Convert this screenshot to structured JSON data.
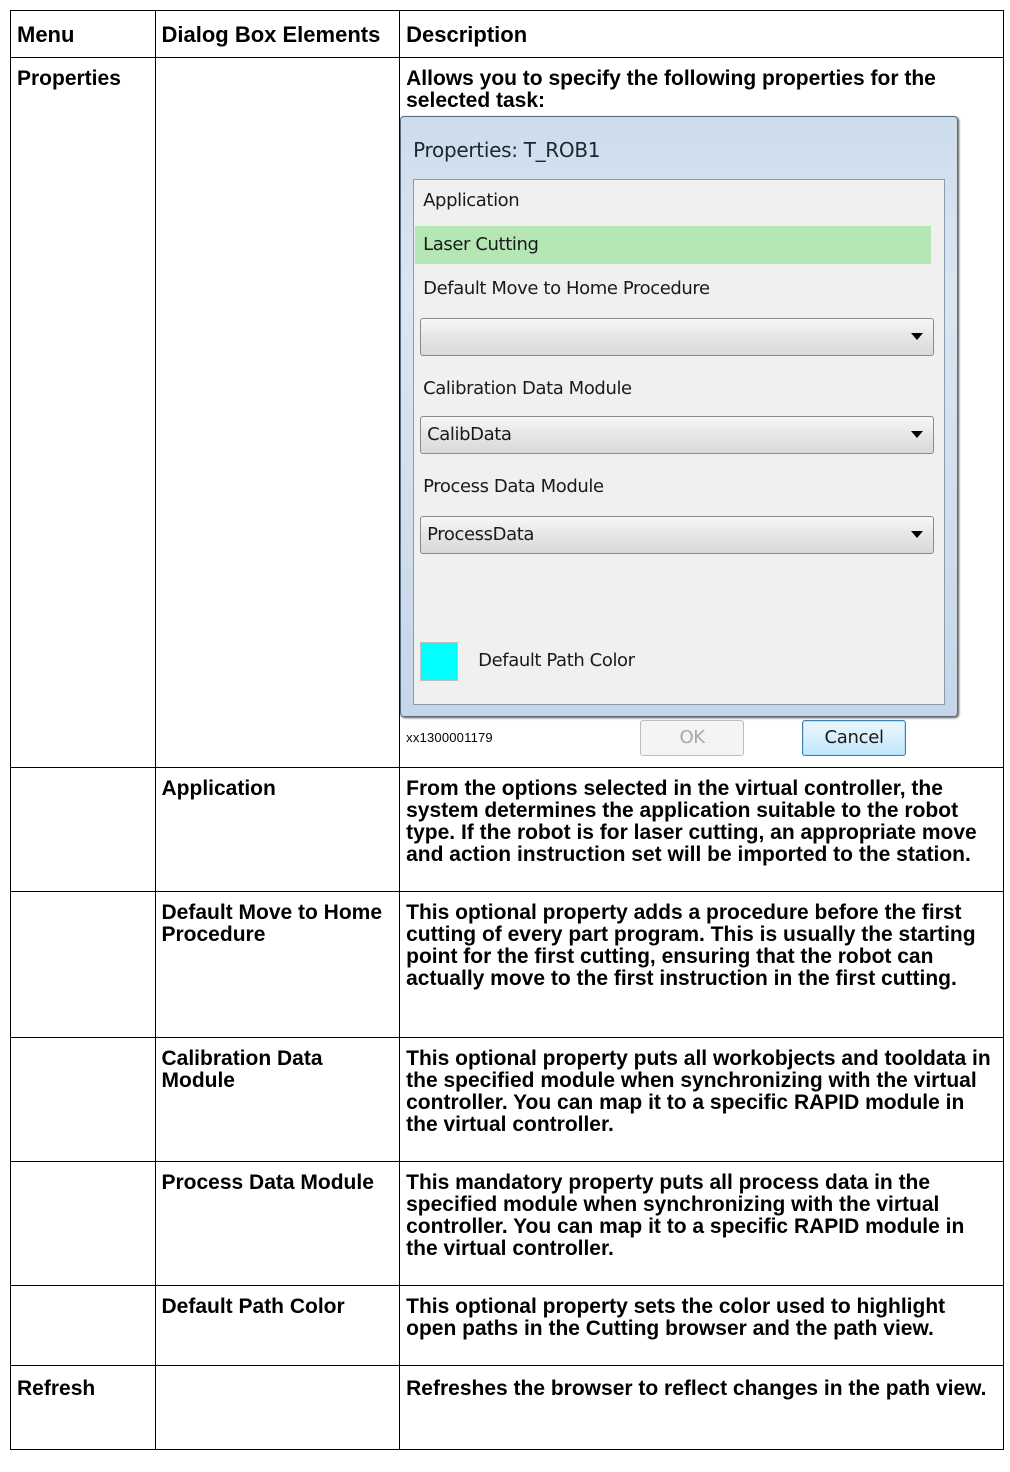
{
  "table": {
    "headers": [
      "Menu",
      "Dialog Box Elements",
      "Description"
    ],
    "rows": {
      "properties": {
        "menu": "Properties",
        "element": "",
        "description": "Allows you to specify the following properties for the selected task:"
      },
      "application": {
        "menu": "",
        "element": "Application",
        "description": "From the options selected in the virtual controller, the system determines the application suitable to the robot type. If the robot is for laser cutting, an appropriate move and action instruction set will be imported to the station."
      },
      "move_home": {
        "menu": "",
        "element": "Default Move to Home Procedure",
        "description": "This optional property adds a procedure before the first cutting of every part program. This is usually the starting point for the first cutting, ensuring that the robot can actually move to the first instruction in the first cutting."
      },
      "calibration": {
        "menu": "",
        "element": "Calibration Data Module",
        "description": "This optional property puts all workobjects and tooldata in the specified module when synchronizing with the virtual controller. You can map it to a specific RAPID module in the virtual controller."
      },
      "process": {
        "menu": "",
        "element": "Process Data Module",
        "description": "This mandatory property puts all process data in the specified module when synchronizing with the virtual controller. You can map it to a specific RAPID module in the virtual controller."
      },
      "path_color": {
        "menu": "",
        "element": "Default Path Color",
        "description": "This optional property sets the color used to highlight open paths in the Cutting browser and the path view."
      },
      "refresh": {
        "menu": "Refresh",
        "element": "",
        "description": "Refreshes the browser to reflect changes in the path view."
      }
    }
  },
  "dialog": {
    "title": "Properties: T_ROB1",
    "application_label": "Application",
    "application_value": "Laser Cutting",
    "move_home_label": "Default Move to Home Procedure",
    "move_home_value": "",
    "calibration_label": "Calibration Data Module",
    "calibration_value": "CalibData",
    "process_label": "Process Data Module",
    "process_value": "ProcessData",
    "path_color_label": "Default Path Color",
    "path_color": "#00ffff",
    "ok_label": "OK",
    "cancel_label": "Cancel",
    "ok_enabled": false,
    "caption": "xx1300001179"
  }
}
